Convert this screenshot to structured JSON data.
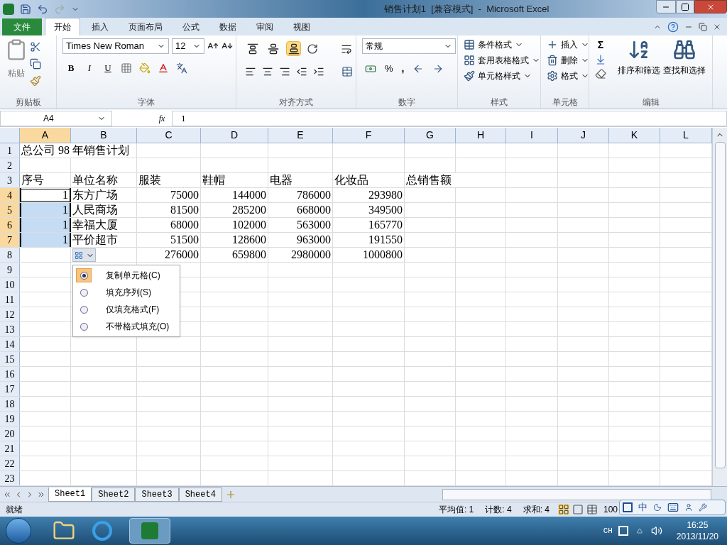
{
  "window": {
    "title": "销售计划1  [兼容模式]  -  Microsoft Excel"
  },
  "ribbon_tabs": [
    {
      "label": "文件",
      "kind": "file",
      "selected": false
    },
    {
      "label": "开始",
      "kind": "tab",
      "selected": true
    },
    {
      "label": "插入",
      "kind": "tab",
      "selected": false
    },
    {
      "label": "页面布局",
      "kind": "tab",
      "selected": false
    },
    {
      "label": "公式",
      "kind": "tab",
      "selected": false
    },
    {
      "label": "数据",
      "kind": "tab",
      "selected": false
    },
    {
      "label": "审阅",
      "kind": "tab",
      "selected": false
    },
    {
      "label": "视图",
      "kind": "tab",
      "selected": false
    }
  ],
  "ribbon": {
    "clipboard": {
      "label": "剪贴板",
      "paste": "粘贴"
    },
    "font": {
      "label": "字体",
      "font_name": "Times New Roman",
      "font_size": "12",
      "bold": "B",
      "italic": "I",
      "underline": "U"
    },
    "alignment": {
      "label": "对齐方式",
      "vertical": [
        {
          "selected": false
        },
        {
          "selected": false
        },
        {
          "selected": true
        }
      ]
    },
    "number": {
      "label": "数字",
      "format": "常规",
      "percent": "%",
      "comma": ","
    },
    "styles": {
      "label": "样式",
      "items": [
        "条件格式",
        "套用表格格式",
        "单元格样式"
      ]
    },
    "cells": {
      "label": "单元格",
      "items": [
        "插入",
        "删除",
        "格式"
      ]
    },
    "editing": {
      "label": "编辑",
      "sum": "Σ",
      "items": [
        "排序和筛选",
        "查找和选择"
      ]
    }
  },
  "formula_bar": {
    "name_box": "A4",
    "fx": "fx",
    "value": "1"
  },
  "columns": [
    {
      "label": "A",
      "selected": true
    },
    {
      "label": "B",
      "selected": false
    },
    {
      "label": "C",
      "selected": false
    },
    {
      "label": "D",
      "selected": false
    },
    {
      "label": "E",
      "selected": false
    },
    {
      "label": "F",
      "selected": false
    },
    {
      "label": "G",
      "selected": false
    },
    {
      "label": "H",
      "selected": false
    },
    {
      "label": "I",
      "selected": false
    },
    {
      "label": "J",
      "selected": false
    },
    {
      "label": "K",
      "selected": false
    },
    {
      "label": "L",
      "selected": false
    }
  ],
  "rows": [
    {
      "number": "1",
      "selected": false,
      "cells": [
        {
          "text": "总公司 98 年销售计划",
          "kind": "text",
          "selected": false,
          "active": false
        }
      ]
    },
    {
      "number": "2",
      "selected": false,
      "cells": []
    },
    {
      "number": "3",
      "selected": false,
      "cells": [
        {
          "text": "序号",
          "kind": "text",
          "selected": false,
          "active": false
        },
        {
          "text": "单位名称",
          "kind": "text",
          "selected": false,
          "active": false
        },
        {
          "text": "服装",
          "kind": "text",
          "selected": false,
          "active": false
        },
        {
          "text": "鞋帽",
          "kind": "text",
          "selected": false,
          "active": false
        },
        {
          "text": "电器",
          "kind": "text",
          "selected": false,
          "active": false
        },
        {
          "text": "化妆品",
          "kind": "text",
          "selected": false,
          "active": false
        },
        {
          "text": "总销售额",
          "kind": "text",
          "selected": false,
          "active": false
        }
      ]
    },
    {
      "number": "4",
      "selected": true,
      "cells": [
        {
          "text": "1",
          "kind": "number",
          "selected": true,
          "active": true
        },
        {
          "text": "东方广场",
          "kind": "text",
          "selected": false,
          "active": false
        },
        {
          "text": "75000",
          "kind": "number",
          "selected": false,
          "active": false
        },
        {
          "text": "144000",
          "kind": "number",
          "selected": false,
          "active": false
        },
        {
          "text": "786000",
          "kind": "number",
          "selected": false,
          "active": false
        },
        {
          "text": "293980",
          "kind": "number",
          "selected": false,
          "active": false
        }
      ]
    },
    {
      "number": "5",
      "selected": true,
      "cells": [
        {
          "text": "1",
          "kind": "number",
          "selected": true,
          "active": false
        },
        {
          "text": "人民商场",
          "kind": "text",
          "selected": false,
          "active": false
        },
        {
          "text": "81500",
          "kind": "number",
          "selected": false,
          "active": false
        },
        {
          "text": "285200",
          "kind": "number",
          "selected": false,
          "active": false
        },
        {
          "text": "668000",
          "kind": "number",
          "selected": false,
          "active": false
        },
        {
          "text": "349500",
          "kind": "number",
          "selected": false,
          "active": false
        }
      ]
    },
    {
      "number": "6",
      "selected": true,
      "cells": [
        {
          "text": "1",
          "kind": "number",
          "selected": true,
          "active": false
        },
        {
          "text": "幸福大厦",
          "kind": "text",
          "selected": false,
          "active": false
        },
        {
          "text": "68000",
          "kind": "number",
          "selected": false,
          "active": false
        },
        {
          "text": "102000",
          "kind": "number",
          "selected": false,
          "active": false
        },
        {
          "text": "563000",
          "kind": "number",
          "selected": false,
          "active": false
        },
        {
          "text": "165770",
          "kind": "number",
          "selected": false,
          "active": false
        }
      ]
    },
    {
      "number": "7",
      "selected": true,
      "cells": [
        {
          "text": "1",
          "kind": "number",
          "selected": true,
          "active": false
        },
        {
          "text": "平价超市",
          "kind": "text",
          "selected": false,
          "active": false
        },
        {
          "text": "51500",
          "kind": "number",
          "selected": false,
          "active": false
        },
        {
          "text": "128600",
          "kind": "number",
          "selected": false,
          "active": false
        },
        {
          "text": "963000",
          "kind": "number",
          "selected": false,
          "active": false
        },
        {
          "text": "191550",
          "kind": "number",
          "selected": false,
          "active": false
        }
      ]
    },
    {
      "number": "8",
      "selected": false,
      "cells": [
        null,
        null,
        {
          "text": "276000",
          "kind": "number",
          "selected": false,
          "active": false
        },
        {
          "text": "659800",
          "kind": "number",
          "selected": false,
          "active": false
        },
        {
          "text": "2980000",
          "kind": "number",
          "selected": false,
          "active": false
        },
        {
          "text": "1000800",
          "kind": "number",
          "selected": false,
          "active": false
        }
      ]
    },
    {
      "number": "9",
      "selected": false,
      "cells": []
    },
    {
      "number": "10",
      "selected": false,
      "cells": []
    },
    {
      "number": "11",
      "selected": false,
      "cells": []
    },
    {
      "number": "12",
      "selected": false,
      "cells": []
    },
    {
      "number": "13",
      "selected": false,
      "cells": []
    },
    {
      "number": "14",
      "selected": false,
      "cells": []
    },
    {
      "number": "15",
      "selected": false,
      "cells": []
    },
    {
      "number": "16",
      "selected": false,
      "cells": []
    },
    {
      "number": "17",
      "selected": false,
      "cells": []
    },
    {
      "number": "18",
      "selected": false,
      "cells": []
    },
    {
      "number": "19",
      "selected": false,
      "cells": []
    },
    {
      "number": "20",
      "selected": false,
      "cells": []
    },
    {
      "number": "21",
      "selected": false,
      "cells": []
    },
    {
      "number": "22",
      "selected": false,
      "cells": []
    },
    {
      "number": "23",
      "selected": false,
      "cells": []
    }
  ],
  "autofill_menu": [
    {
      "label": "复制单元格(C)",
      "selected": true
    },
    {
      "label": "填充序列(S)",
      "selected": false
    },
    {
      "label": "仅填充格式(F)",
      "selected": false
    },
    {
      "label": "不带格式填充(O)",
      "selected": false
    }
  ],
  "sheet_tabs": [
    {
      "label": "Sheet1",
      "selected": true
    },
    {
      "label": "Sheet2",
      "selected": false
    },
    {
      "label": "Sheet3",
      "selected": false
    },
    {
      "label": "Sheet4",
      "selected": false
    }
  ],
  "status_bar": {
    "mode": "就绪",
    "average": "平均值: 1",
    "count": "计数: 4",
    "sum": "求和: 4",
    "zoom": "100"
  },
  "ime_bar": {
    "mode": "中"
  },
  "taskbar": {
    "language": "CH",
    "time": "16:25",
    "date": "2013/11/20"
  }
}
